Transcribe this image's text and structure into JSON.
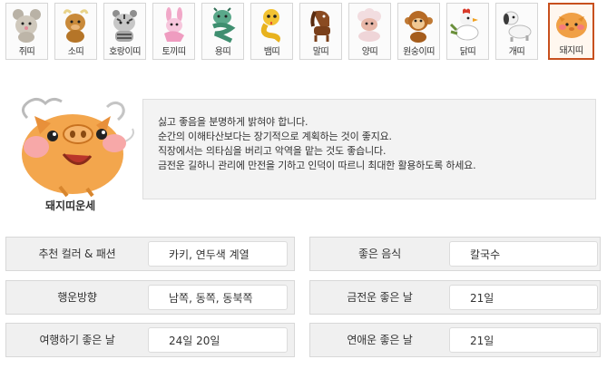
{
  "zodiac": {
    "tabs": [
      {
        "label": "쥐띠",
        "icon": "rat-icon"
      },
      {
        "label": "소띠",
        "icon": "ox-icon"
      },
      {
        "label": "호랑이띠",
        "icon": "tiger-icon"
      },
      {
        "label": "토끼띠",
        "icon": "rabbit-icon"
      },
      {
        "label": "용띠",
        "icon": "dragon-icon"
      },
      {
        "label": "뱀띠",
        "icon": "snake-icon"
      },
      {
        "label": "말띠",
        "icon": "horse-icon"
      },
      {
        "label": "양띠",
        "icon": "sheep-icon"
      },
      {
        "label": "원숭이띠",
        "icon": "monkey-icon"
      },
      {
        "label": "닭띠",
        "icon": "rooster-icon"
      },
      {
        "label": "개띠",
        "icon": "dog-icon"
      },
      {
        "label": "돼지띠",
        "icon": "pig-icon"
      }
    ],
    "selected_index": 11,
    "selected_color": "#c8501e"
  },
  "fortune": {
    "caption": "돼지띠운세",
    "lines": [
      "싫고 좋음을 분명하게 밝혀야 합니다.",
      "순간의 이해타산보다는 장기적으로 계획하는 것이 좋지요.",
      "직장에서는 의타심을 버리고 악역을 맡는 것도 좋습니다.",
      "금전운 길하니 관리에 만전을 기하고 인덕이 따르니 최대한 활용하도록 하세요."
    ]
  },
  "info": {
    "left": [
      {
        "label": "추천 컬러 & 패션",
        "value": "카키, 연두색 계열"
      },
      {
        "label": "행운방향",
        "value": "남쪽, 동쪽, 동북쪽"
      },
      {
        "label": "여행하기 좋은 날",
        "value": "24일 20일"
      }
    ],
    "right": [
      {
        "label": "좋은 음식",
        "value": "칼국수"
      },
      {
        "label": "금전운 좋은 날",
        "value": "21일"
      },
      {
        "label": "연애운 좋은 날",
        "value": "21일"
      }
    ]
  }
}
